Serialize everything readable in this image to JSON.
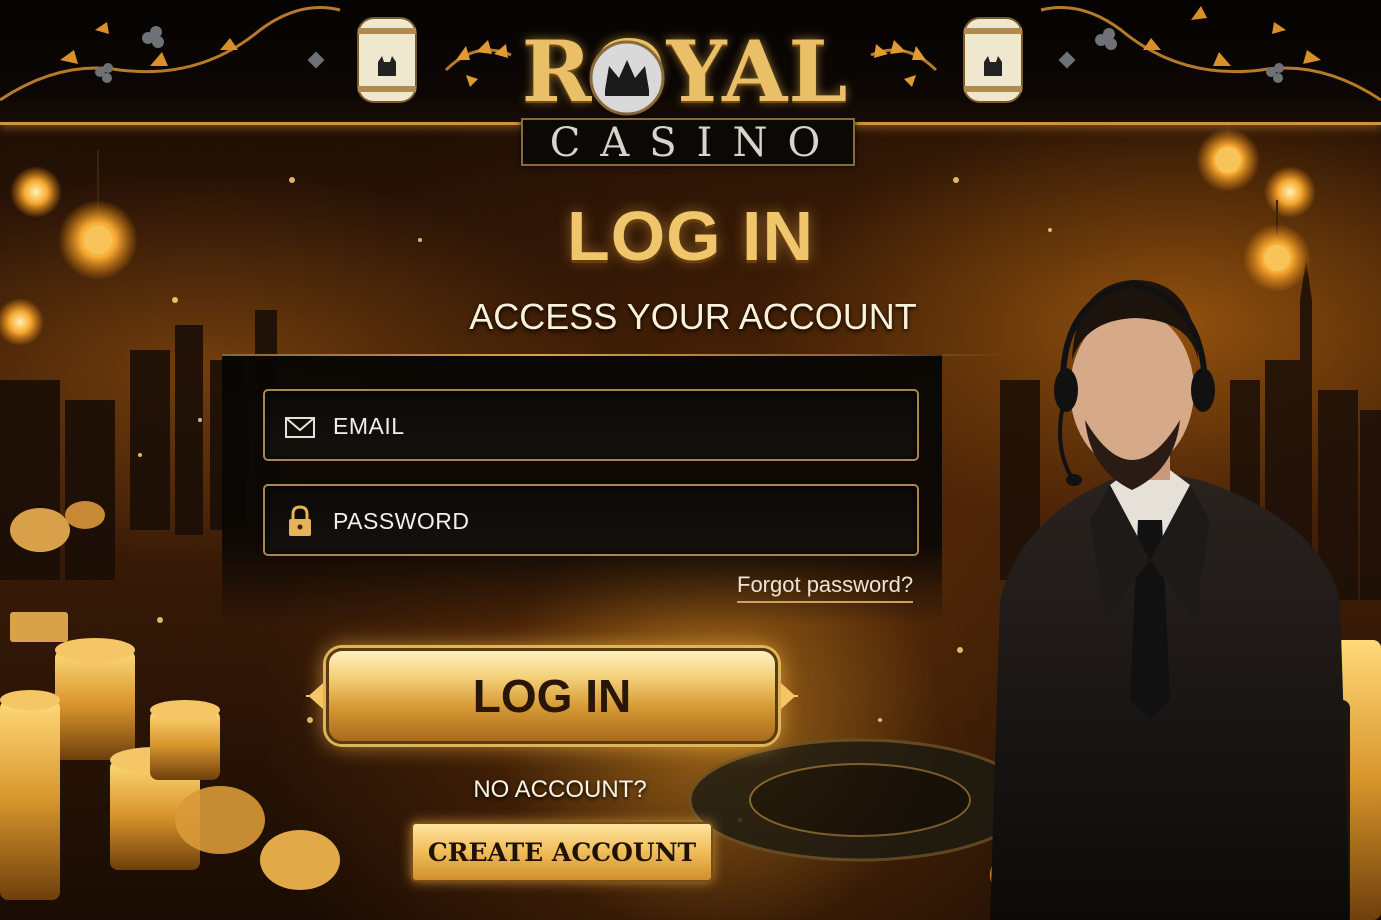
{
  "brand": {
    "name_top": "ROYAL",
    "name_bottom": "CASINO"
  },
  "page": {
    "title": "LOG IN",
    "subtitle": "ACCESS YOUR ACCOUNT"
  },
  "form": {
    "email_placeholder": "EMAIL",
    "email_icon": "envelope-icon",
    "password_placeholder": "PASSWORD",
    "password_icon": "lock-icon",
    "forgot_link": "Forgot password?",
    "login_button": "LOG IN",
    "no_account_text": "NO ACCOUNT?",
    "create_account_button": "CREATE ACCOUNT"
  },
  "colors": {
    "accent_gold": "#e9c068",
    "background_dark": "#120904",
    "button_text": "#2a1606"
  }
}
